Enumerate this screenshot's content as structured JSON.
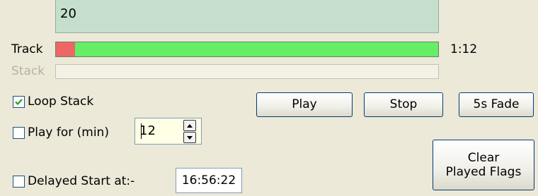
{
  "list": {
    "value": "20"
  },
  "track": {
    "label": "Track",
    "time": "1:12",
    "played_fraction": 0.05
  },
  "stack": {
    "label": "Stack"
  },
  "loop_stack": {
    "label": "Loop Stack",
    "checked": true
  },
  "play_for": {
    "label": "Play for (min)",
    "checked": false,
    "value": "12"
  },
  "delayed_start": {
    "label": "Delayed Start at:-",
    "checked": false,
    "time": "16:56:22"
  },
  "buttons": {
    "play": "Play",
    "stop": "Stop",
    "fade": "5s Fade",
    "clear_line1": "Clear",
    "clear_line2": "Played Flags"
  },
  "colors": {
    "played": "#ee6666",
    "remaining": "#66ee66",
    "list_bg": "#c5dfcc",
    "spin_bg": "#ffffe6"
  }
}
